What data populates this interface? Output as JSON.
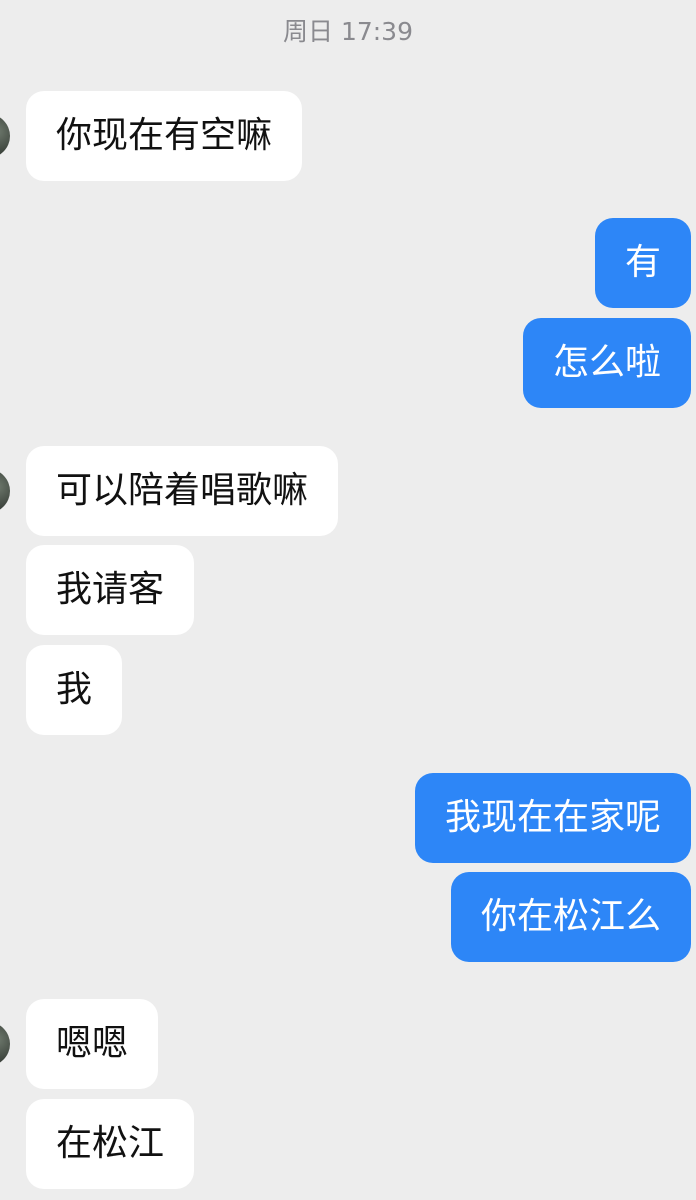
{
  "chat": {
    "timestamp": "周日 17:39",
    "messages": [
      {
        "side": "in",
        "text": "你现在有空嘛"
      },
      {
        "side": "out",
        "text": "有"
      },
      {
        "side": "out",
        "text": "怎么啦"
      },
      {
        "side": "in",
        "text": "可以陪着唱歌嘛"
      },
      {
        "side": "in",
        "text": "我请客"
      },
      {
        "side": "in",
        "text": "我"
      },
      {
        "side": "out",
        "text": "我现在在家呢"
      },
      {
        "side": "out",
        "text": "你在松江么"
      },
      {
        "side": "in",
        "text": "嗯嗯"
      },
      {
        "side": "in",
        "text": "在松江"
      }
    ]
  },
  "colors": {
    "background": "#ededed",
    "incoming_bubble": "#ffffff",
    "outgoing_bubble": "#2d86f7",
    "incoming_text": "#111111",
    "outgoing_text": "#ffffff",
    "timestamp_text": "#8a8a8f"
  },
  "icons": {
    "avatar": "contact-avatar"
  }
}
